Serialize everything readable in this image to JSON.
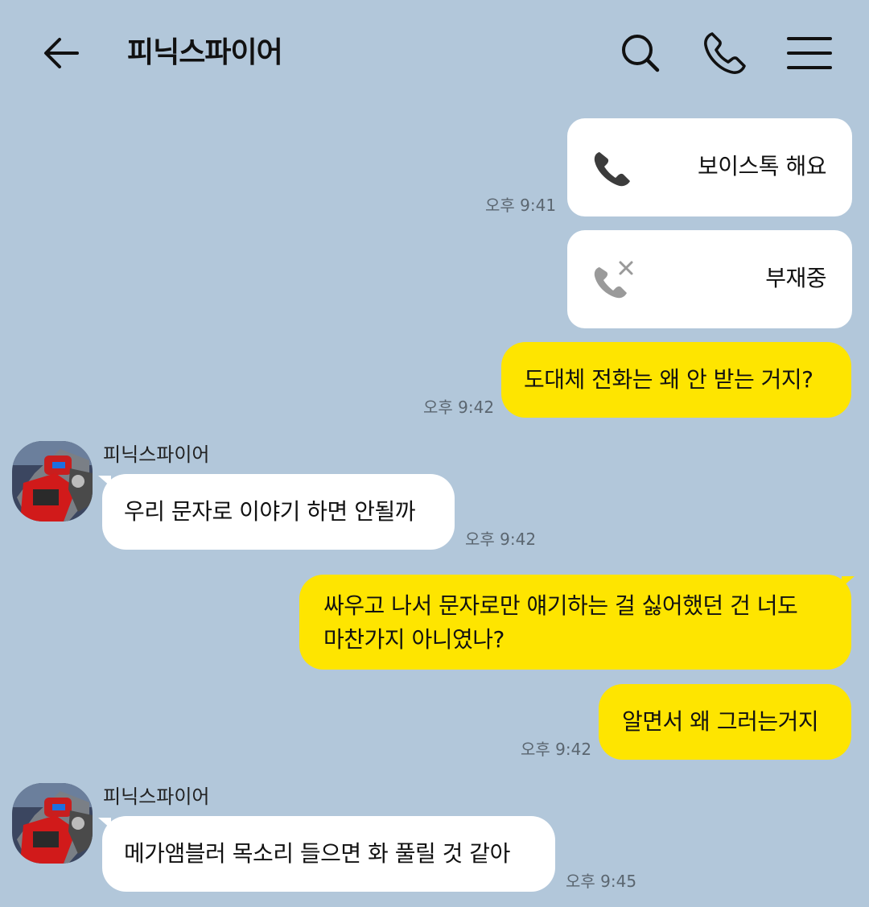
{
  "header": {
    "title": "피닉스파이어"
  },
  "messages": {
    "call1": {
      "label": "보이스톡 해요",
      "time": "오후 9:41"
    },
    "call2": {
      "label": "부재중"
    },
    "m1": {
      "text": "도대체 전화는 왜 안 받는 거지?",
      "time": "오후 9:42"
    },
    "m2": {
      "sender": "피닉스파이어",
      "text": "우리 문자로 이야기 하면 안될까",
      "time": "오후 9:42"
    },
    "m3": {
      "line1": "싸우고 나서 문자로만 얘기하는 걸 싫어했던 건 너도",
      "line2": "마찬가지 아니였나?"
    },
    "m4": {
      "text": "알면서 왜 그러는거지",
      "time": "오후 9:42"
    },
    "m5": {
      "sender": "피닉스파이어",
      "text": "메가앰블러 목소리 들으면 화 풀릴 것 같아",
      "time": "오후 9:45"
    }
  },
  "colors": {
    "background": "#b2c7da",
    "my_bubble": "#fee500",
    "their_bubble": "#ffffff"
  },
  "icons": {
    "back": "arrow-left-icon",
    "search": "search-icon",
    "call": "phone-icon",
    "menu": "hamburger-menu-icon",
    "voice_call": "phone-handset-icon",
    "missed_call": "missed-call-icon"
  }
}
